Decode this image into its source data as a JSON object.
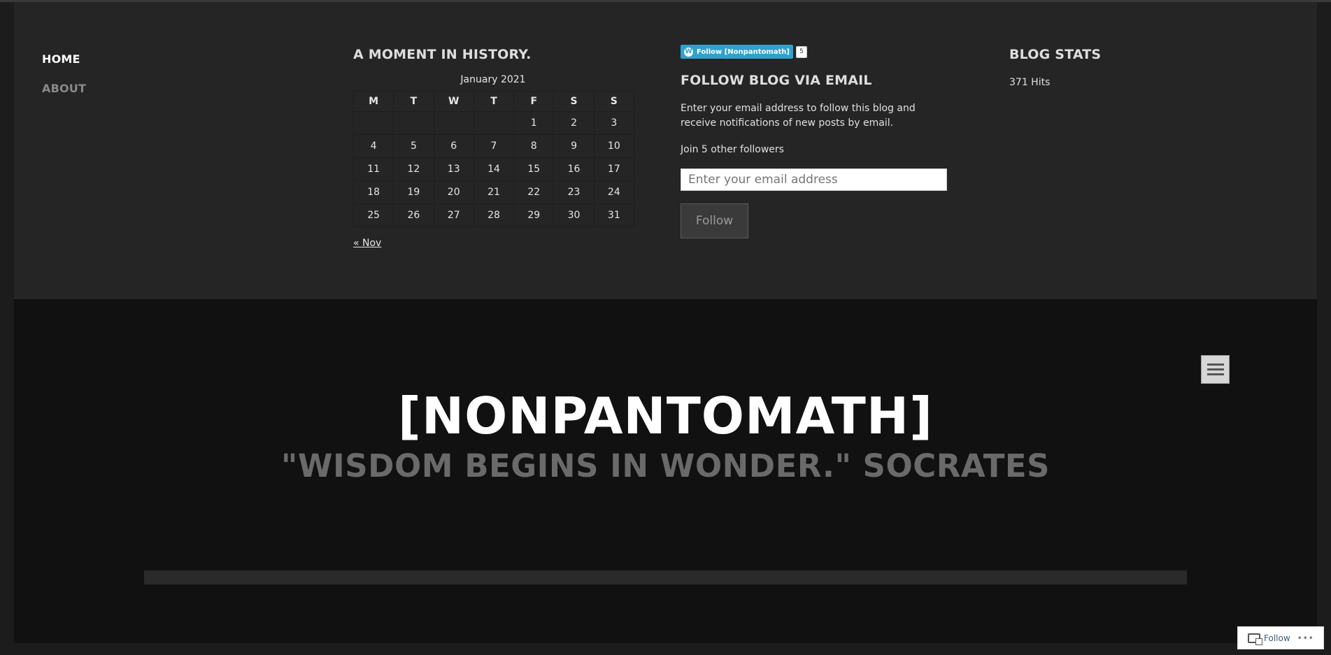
{
  "nav": {
    "items": [
      {
        "label": "HOME"
      },
      {
        "label": "ABOUT"
      }
    ]
  },
  "calendar_widget": {
    "title": "A MOMENT IN HISTORY.",
    "caption": "January 2021",
    "weekdays": [
      "M",
      "T",
      "W",
      "T",
      "F",
      "S",
      "S"
    ],
    "weeks": [
      [
        "",
        "",
        "",
        "",
        "1",
        "2",
        "3"
      ],
      [
        "4",
        "5",
        "6",
        "7",
        "8",
        "9",
        "10"
      ],
      [
        "11",
        "12",
        "13",
        "14",
        "15",
        "16",
        "17"
      ],
      [
        "18",
        "19",
        "20",
        "21",
        "22",
        "23",
        "24"
      ],
      [
        "25",
        "26",
        "27",
        "28",
        "29",
        "30",
        "31"
      ]
    ],
    "prev_link": "« Nov"
  },
  "follow_widget": {
    "wp_button_label": "Follow [Nonpantomath]",
    "wp_count": "5",
    "title": "FOLLOW BLOG VIA EMAIL",
    "description": "Enter your email address to follow this blog and receive notifications of new posts by email.",
    "join_text": "Join 5 other followers",
    "email_placeholder": "Enter your email address",
    "button_label": "Follow"
  },
  "stats_widget": {
    "title": "BLOG STATS",
    "hits": "371 Hits"
  },
  "header": {
    "site_title": "[NONPANTOMATH]",
    "site_description": "\"WISDOM BEGINS IN WONDER.\" SOCRATES"
  },
  "bottom_bar": {
    "follow_label": "Follow",
    "more_label": "•••"
  },
  "colors": {
    "widget_bg": "#252525",
    "header_bg": "#111111",
    "wp_blue": "#2ea2cc"
  }
}
